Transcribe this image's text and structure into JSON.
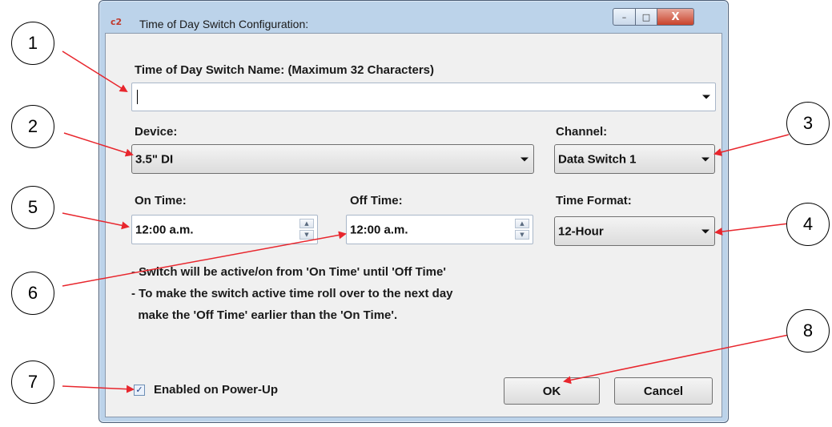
{
  "window": {
    "app_icon": "c2",
    "title": "Time of Day Switch Configuration:",
    "buttons": {
      "minimize": "–",
      "maximize": "□",
      "close": "X"
    }
  },
  "form": {
    "name_label": "Time of Day Switch Name: (Maximum 32 Characters)",
    "name_value": "",
    "device_label": "Device:",
    "device_value": "3.5\" DI",
    "channel_label": "Channel:",
    "channel_value": "Data Switch 1",
    "on_time_label": "On Time:",
    "on_time_value": "12:00 a.m.",
    "off_time_label": "Off Time:",
    "off_time_value": "12:00 a.m.",
    "time_format_label": "Time Format:",
    "time_format_value": "12-Hour",
    "notes": [
      "- Switch will be active/on from 'On Time' until 'Off Time'",
      "- To make the switch active time roll over to the next day",
      "  make the 'Off Time' earlier than the 'On Time'."
    ],
    "enabled_label": "Enabled on Power-Up",
    "enabled_checked": true,
    "ok_label": "OK",
    "cancel_label": "Cancel"
  },
  "callouts": [
    "1",
    "2",
    "3",
    "4",
    "5",
    "6",
    "7",
    "8"
  ],
  "colors": {
    "callout_arrow": "#e8262d"
  }
}
